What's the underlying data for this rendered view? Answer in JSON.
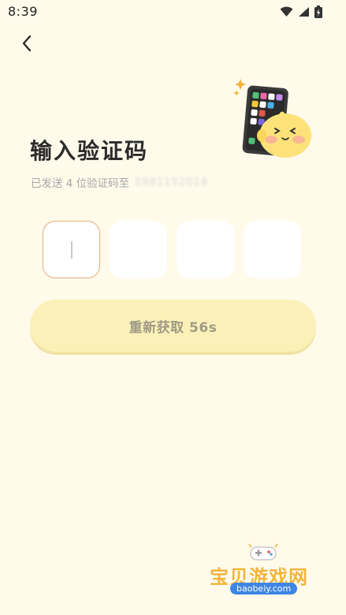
{
  "status_bar": {
    "time": "8:39",
    "icons": [
      "wifi-icon",
      "signal-icon",
      "battery-charging-icon"
    ]
  },
  "header": {
    "back_icon": "chevron-left-icon"
  },
  "main": {
    "title": "输入验证码",
    "subtitle_prefix": "已发送 4 位验证码至",
    "phone_masked": "1881152014",
    "code_boxes": [
      "",
      "",
      "",
      ""
    ],
    "resend_label": "重新获取 56s"
  },
  "watermark": {
    "text_cn": "宝贝游戏网",
    "text_en": "baobeiy.com"
  },
  "colors": {
    "background": "#fffaea",
    "button_bg": "#fbf1b8",
    "button_text": "#a09a86",
    "active_border": "#e8ad7a",
    "mascot_yellow": "#fde27a"
  }
}
